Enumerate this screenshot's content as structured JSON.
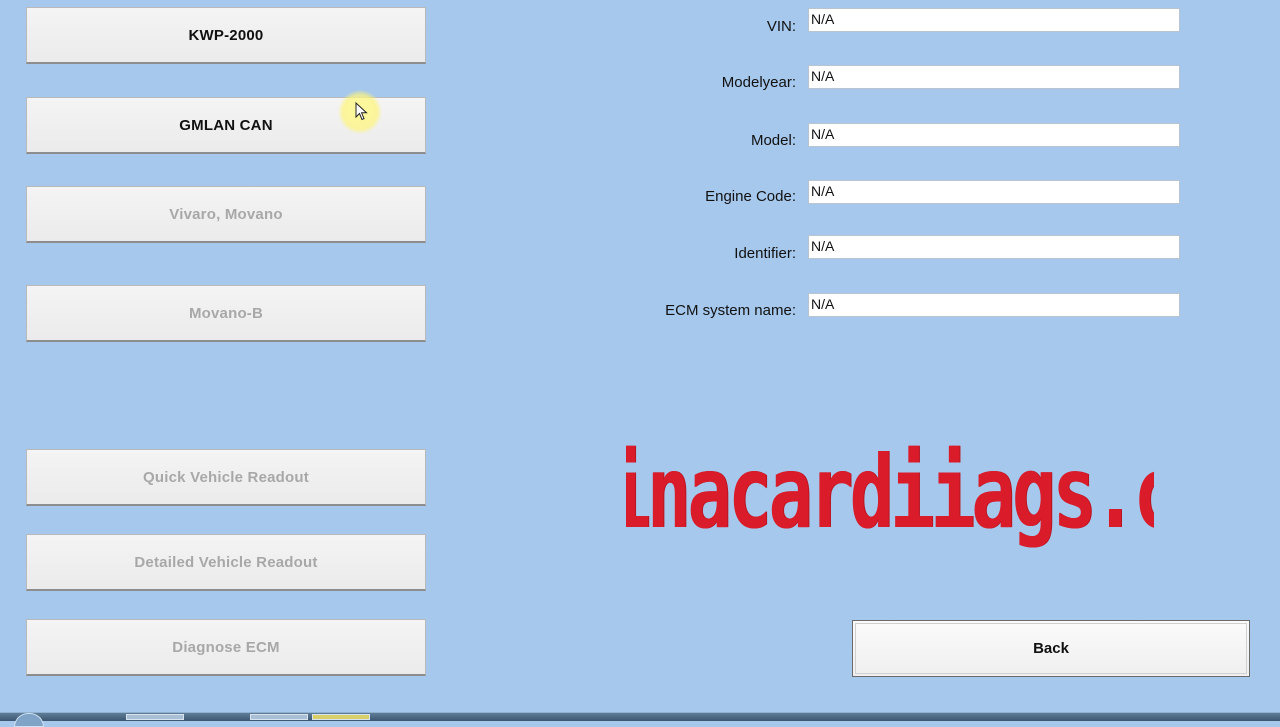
{
  "protocols": [
    {
      "label": "KWP-2000",
      "enabled": true
    },
    {
      "label": "GMLAN CAN",
      "enabled": true
    },
    {
      "label": "Vivaro, Movano",
      "enabled": false
    },
    {
      "label": "Movano-B",
      "enabled": false
    }
  ],
  "actions": [
    {
      "label": "Quick Vehicle Readout",
      "enabled": false
    },
    {
      "label": "Detailed Vehicle Readout",
      "enabled": false
    },
    {
      "label": "Diagnose ECM",
      "enabled": false
    }
  ],
  "fields": [
    {
      "label": "VIN:",
      "value": "N/A"
    },
    {
      "label": "Modelyear:",
      "value": "N/A"
    },
    {
      "label": "Model:",
      "value": "N/A"
    },
    {
      "label": "Engine Code:",
      "value": "N/A"
    },
    {
      "label": "Identifier:",
      "value": "N/A"
    },
    {
      "label": "ECM system name:",
      "value": "N/A"
    }
  ],
  "watermark": "chinacardiiags.com",
  "back_label": "Back",
  "colors": {
    "background": "#a6c8ec",
    "watermark": "#d91b2a",
    "disabled_text": "#a8a8a8"
  }
}
